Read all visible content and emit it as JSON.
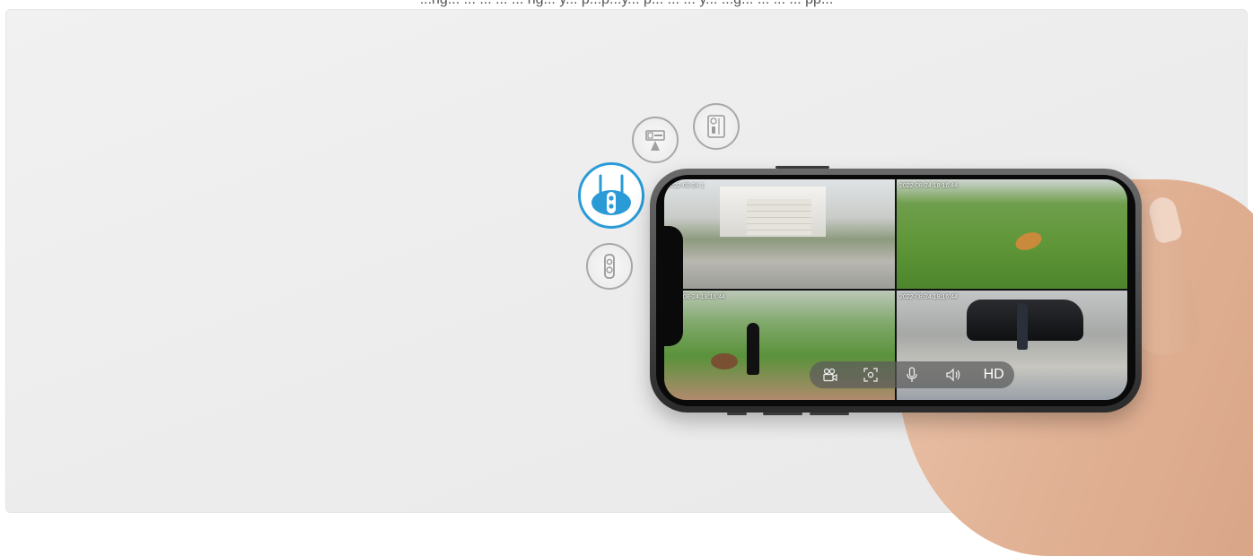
{
  "caption": "...ng... ... ... ... ... ng... y... p...p...y... p... ... ... y... ...g... ... ... ... pp...",
  "feeds": [
    {
      "timestamp": "2022-08-24 1"
    },
    {
      "timestamp": "2022-08-24 18:16:44"
    },
    {
      "timestamp": "2022-08-24 18:16:44"
    },
    {
      "timestamp": "2022-08-24 18:16:44"
    }
  ],
  "controls": {
    "hd_label": "HD",
    "icons": [
      "video-camera-icon",
      "snapshot-icon",
      "microphone-icon",
      "speaker-icon"
    ]
  },
  "device_icons": [
    "floodlight-camera-icon",
    "doorbell-camera-icon",
    "wireless-camera-icon",
    "doorbell-icon"
  ],
  "colors": {
    "accent": "#2a9bd7",
    "icon_gray": "#a8a8a8"
  }
}
